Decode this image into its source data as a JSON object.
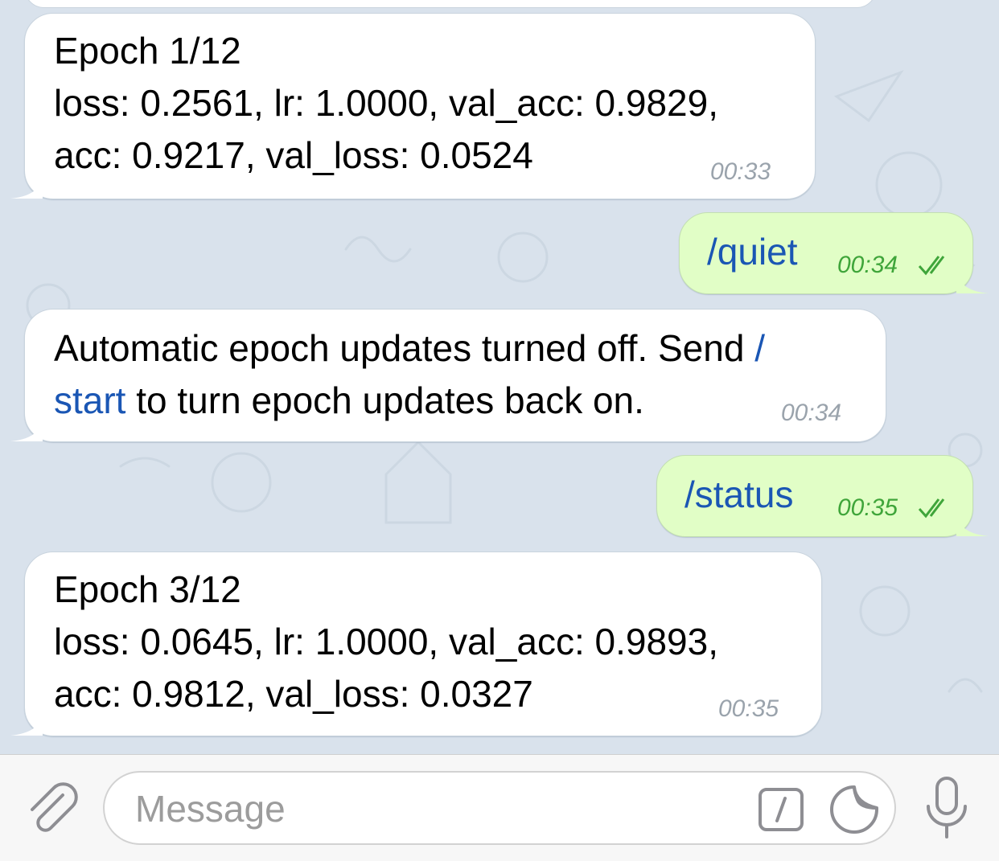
{
  "messages": [
    {
      "type": "incoming",
      "lines": [
        "Epoch 1/12",
        "loss: 0.2561, lr: 1.0000, val_acc: 0.9829,",
        "acc: 0.9217, val_loss: 0.0524"
      ],
      "time": "00:33"
    },
    {
      "type": "outgoing",
      "text": "/quiet",
      "time": "00:34",
      "status": "read"
    },
    {
      "type": "incoming",
      "line1_prefix": "Automatic epoch updates turned off. Send ",
      "line1_cmd": "/",
      "line2_cmd": "start",
      "line2_suffix": " to turn epoch updates back on.",
      "time": "00:34"
    },
    {
      "type": "outgoing",
      "text": "/status",
      "time": "00:35",
      "status": "read"
    },
    {
      "type": "incoming",
      "lines": [
        "Epoch 3/12",
        "loss: 0.0645, lr: 1.0000, val_acc: 0.9893,",
        "acc: 0.9812, val_loss: 0.0327"
      ],
      "time": "00:35"
    }
  ],
  "input": {
    "placeholder": "Message"
  },
  "colors": {
    "chat_background": "#d9e2ec",
    "incoming_bubble": "#ffffff",
    "outgoing_bubble": "#e1fec6",
    "command_link": "#1a56b4",
    "outgoing_time": "#3fa53a",
    "incoming_time": "#9aa3ac",
    "icon_gray": "#8e8e93"
  },
  "icons": {
    "attach": "paperclip-icon",
    "commands": "slash-command-icon",
    "sticker": "sticker-icon",
    "voice": "microphone-icon",
    "read_status": "double-check-icon"
  }
}
